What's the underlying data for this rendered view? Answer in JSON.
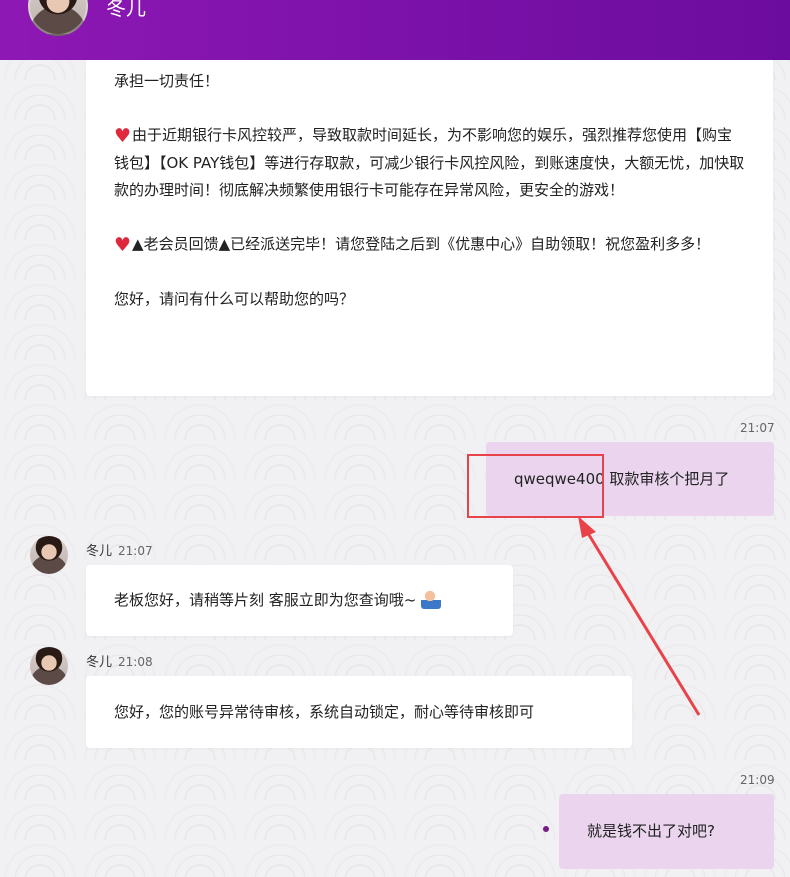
{
  "header": {
    "agent_name": "冬儿"
  },
  "messages": {
    "first": {
      "line_partial": "承担一切责任！",
      "para1": "由于近期银行卡风控较严，导致取款时间延长，为不影响您的娱乐，强烈推荐您使用【购宝钱包】【OK PAY钱包】等进行存取款，可减少银行卡风控风险，到账速度快，大额无忧，加快取款的办理时间！彻底解决频繁使用银行卡可能存在异常风险，更安全的游戏！",
      "para2": "▲老会员回馈▲已经派送完毕！请您登陆之后到《优惠中心》自助领取！祝您盈利多多！",
      "para3": "您好，请问有什么可以帮助您的吗？"
    },
    "user1": {
      "time": "21:07",
      "text": "qweqwe400 取款审核个把月了"
    },
    "agent1": {
      "name": "冬儿",
      "time": "21:07",
      "text": "老板您好，请稍等片刻 客服立即为您查询哦~"
    },
    "agent2": {
      "name": "冬儿",
      "time": "21:08",
      "text": "您好，您的账号异常待审核，系统自动锁定，耐心等待审核即可"
    },
    "user2": {
      "time": "21:09",
      "text": "就是钱不出了对吧?"
    }
  },
  "icons": {
    "heart": "heart-icon",
    "emoji": "customer-service-emoji-icon",
    "avatar": "agent-avatar"
  },
  "colors": {
    "header": "#8e18b4",
    "user_bubble": "#ead4ee",
    "annotation": "#e8434a",
    "heart": "#e0283d"
  }
}
